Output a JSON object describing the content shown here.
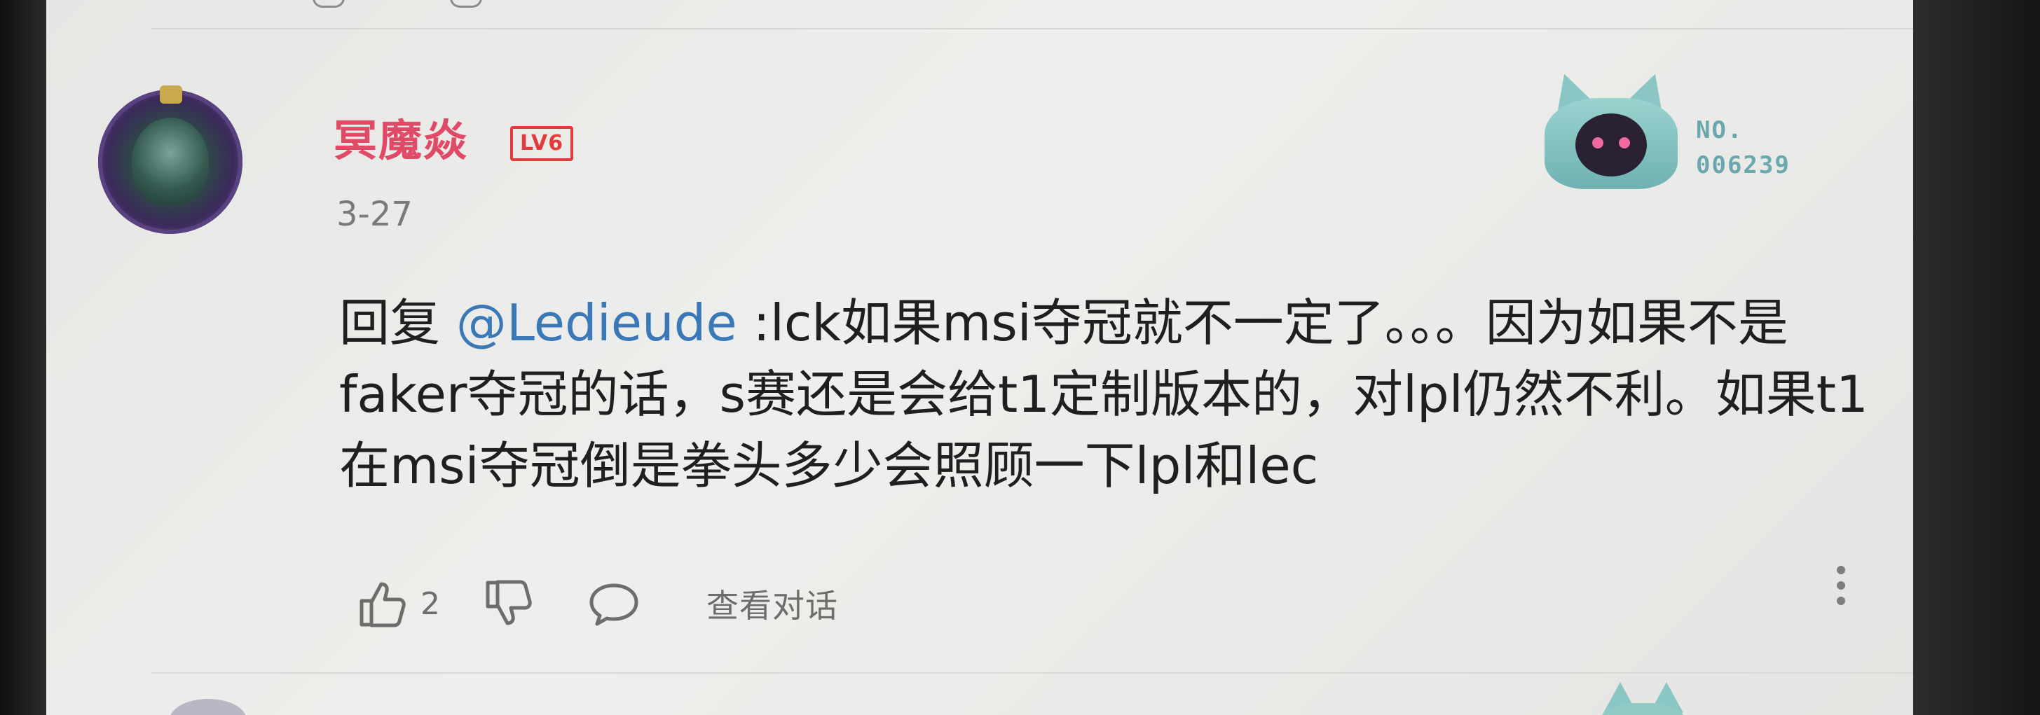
{
  "comment": {
    "username": "冥魔焱",
    "level_badge": "LV6",
    "date": "3-27",
    "reply_prefix": "回复 ",
    "mention": "@Ledieude",
    "text": " :lck如果msi夺冠就不一定了。。。因为如果不是faker夺冠的话，s赛还是会给t1定制版本的，对lpl仍然不利。如果t1在msi夺冠倒是拳头多少会照顾一下lpl和lec",
    "like_count": "2",
    "view_conversation_label": "查看对话"
  },
  "fan_badge": {
    "no_label": "NO.",
    "number": "006239"
  },
  "icons": {
    "like": "thumbs-up-icon",
    "dislike": "thumbs-down-icon",
    "reply": "chat-bubble-icon",
    "more": "more-vertical-icon"
  },
  "colors": {
    "username": "#e04a66",
    "level_badge": "#e23b3b",
    "mention": "#3a78b8",
    "fan_badge_text": "#6aa8ad"
  }
}
